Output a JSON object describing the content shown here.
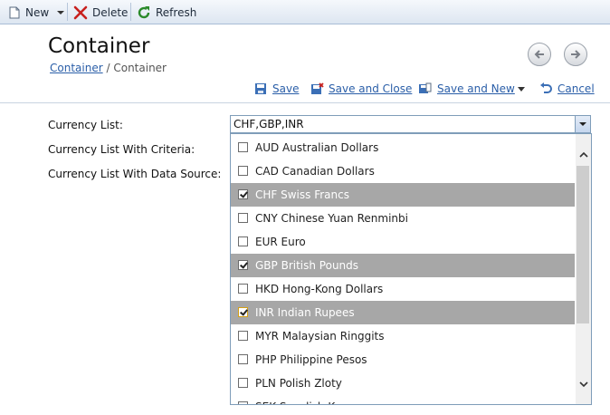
{
  "toolbar": {
    "new_label": "New",
    "delete_label": "Delete",
    "refresh_label": "Refresh"
  },
  "page": {
    "title": "Container",
    "breadcrumb_link": "Container",
    "breadcrumb_sep": "/",
    "breadcrumb_current": "Container"
  },
  "actions": {
    "save": "Save",
    "save_close": "Save and Close",
    "save_new": "Save and New",
    "cancel": "Cancel"
  },
  "form": {
    "labels": [
      "Currency List:",
      "Currency List With Criteria:",
      "Currency List With Data Source:"
    ],
    "currency_value": "CHF,GBP,INR"
  },
  "dropdown": {
    "items": [
      {
        "label": "AUD Australian Dollars",
        "checked": false
      },
      {
        "label": "CAD Canadian Dollars",
        "checked": false
      },
      {
        "label": "CHF Swiss Francs",
        "checked": true
      },
      {
        "label": "CNY Chinese Yuan Renminbi",
        "checked": false
      },
      {
        "label": "EUR Euro",
        "checked": false
      },
      {
        "label": "GBP British Pounds",
        "checked": true
      },
      {
        "label": "HKD Hong-Kong Dollars",
        "checked": false
      },
      {
        "label": "INR Indian Rupees",
        "checked": true,
        "focused": true
      },
      {
        "label": "MYR Malaysian Ringgits",
        "checked": false
      },
      {
        "label": "PHP Philippine Pesos",
        "checked": false
      },
      {
        "label": "PLN Polish Zloty",
        "checked": false
      },
      {
        "label": "SEK Swedish K",
        "checked": false
      }
    ]
  }
}
